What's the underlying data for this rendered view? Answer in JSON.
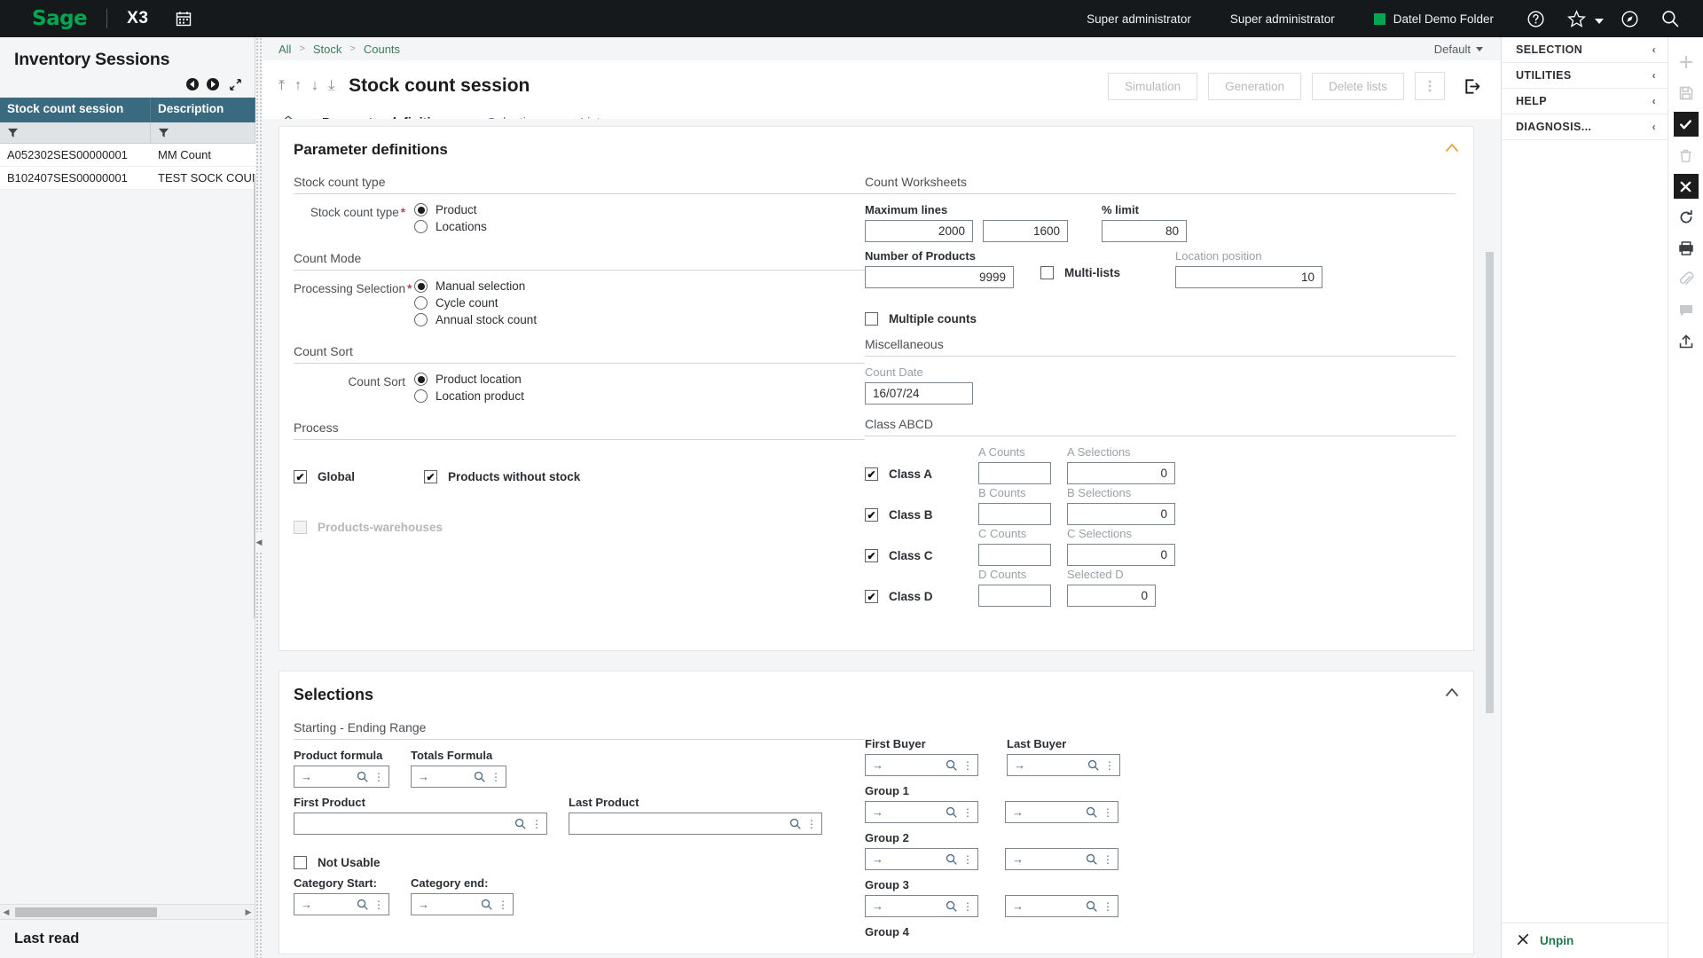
{
  "topbar": {
    "logo": "Sage",
    "product": "X3",
    "calendar_icon": "calendar-icon",
    "user_left": "Super administrator",
    "user_right": "Super administrator",
    "folder": "Datel Demo Folder",
    "icons": [
      "help-icon",
      "favorites-star-icon",
      "chevron-down-icon",
      "compass-icon",
      "search-icon"
    ]
  },
  "left_panel": {
    "title": "Inventory Sessions",
    "nav_prev": "◀",
    "nav_next": "▶",
    "expand_icon": "expand-icon",
    "columns": [
      "Stock count session",
      "Description"
    ],
    "filter_icon": "filter-icon",
    "rows": [
      {
        "session": "A052302SES00000001",
        "description": "MM Count"
      },
      {
        "session": "B102407SES00000001",
        "description": "TEST SOCK COUNT"
      }
    ],
    "footer_status": "Last read"
  },
  "breadcrumb": {
    "items": [
      "All",
      "Stock",
      "Counts"
    ],
    "separator": ">",
    "view_label": "Default"
  },
  "page": {
    "title": "Stock count session",
    "nav_icons": [
      "first-record-icon",
      "previous-record-icon",
      "next-record-icon",
      "last-record-icon"
    ],
    "buttons": [
      {
        "label": "Simulation",
        "name": "simulation-button"
      },
      {
        "label": "Generation",
        "name": "generation-button"
      },
      {
        "label": "Delete lists",
        "name": "delete-lists-button"
      }
    ],
    "kebab_icon": "more-options-icon",
    "exit_icon": "exit-icon",
    "tabs": [
      {
        "label": "Parameter definitions",
        "active": true
      },
      {
        "label": "Selections",
        "active": false
      },
      {
        "label": "Lists",
        "active": false
      }
    ],
    "home_icon": "home-icon"
  },
  "parameter_definitions": {
    "card_title": "Parameter definitions",
    "collapse_icon": "collapse-icon",
    "stock_count_type": {
      "section": "Stock count type",
      "label": "Stock count type",
      "required": "*",
      "options": [
        {
          "label": "Product",
          "selected": true
        },
        {
          "label": "Locations",
          "selected": false
        }
      ]
    },
    "count_mode": {
      "section": "Count Mode",
      "label": "Processing Selection",
      "required": "*",
      "options": [
        {
          "label": "Manual selection",
          "selected": true
        },
        {
          "label": "Cycle count",
          "selected": false
        },
        {
          "label": "Annual stock count",
          "selected": false
        }
      ]
    },
    "count_sort": {
      "section": "Count Sort",
      "label": "Count Sort",
      "options": [
        {
          "label": "Product location",
          "selected": true
        },
        {
          "label": "Location product",
          "selected": false
        }
      ]
    },
    "process": {
      "section": "Process",
      "checkboxes": [
        {
          "label": "Global",
          "checked": true,
          "disabled": false
        },
        {
          "label": "Products without stock",
          "checked": true,
          "disabled": false
        },
        {
          "label": "Products-warehouses",
          "checked": false,
          "disabled": true
        }
      ]
    },
    "count_worksheets": {
      "section": "Count Worksheets",
      "maximum_lines_label": "Maximum lines",
      "maximum_lines_value": "2000",
      "maximum_lines_value2": "1600",
      "percent_limit_label": "% limit",
      "percent_limit_value": "80",
      "number_of_products_label": "Number of Products",
      "number_of_products_value": "9999",
      "multi_lists_label": "Multi-lists",
      "multi_lists_checked": false,
      "location_position_label": "Location position",
      "location_position_value": "10",
      "multiple_counts_label": "Multiple counts",
      "multiple_counts_checked": false
    },
    "miscellaneous": {
      "section": "Miscellaneous",
      "count_date_label": "Count Date",
      "count_date_value": "16/07/24"
    },
    "class_abcd": {
      "section": "Class ABCD",
      "rows": [
        {
          "class_label": "Class A",
          "checked": true,
          "counts_label": "A Counts",
          "counts_value": "",
          "selections_label": "A Selections",
          "selections_value": "0"
        },
        {
          "class_label": "Class B",
          "checked": true,
          "counts_label": "B Counts",
          "counts_value": "",
          "selections_label": "B Selections",
          "selections_value": "0"
        },
        {
          "class_label": "Class C",
          "checked": true,
          "counts_label": "C Counts",
          "counts_value": "",
          "selections_label": "C Selections",
          "selections_value": "0"
        },
        {
          "class_label": "Class D",
          "checked": true,
          "counts_label": "D Counts",
          "counts_value": "",
          "selections_label": "Selected D",
          "selections_value": "0"
        }
      ]
    }
  },
  "selections": {
    "card_title": "Selections",
    "collapse_icon": "collapse-icon",
    "range_section": "Starting - Ending Range",
    "left": {
      "product_formula_label": "Product formula",
      "totals_formula_label": "Totals Formula",
      "first_product_label": "First Product",
      "last_product_label": "Last Product",
      "not_usable_label": "Not Usable",
      "not_usable_checked": false,
      "category_start_label": "Category Start:",
      "category_end_label": "Category end:"
    },
    "right": {
      "first_buyer_label": "First Buyer",
      "last_buyer_label": "Last Buyer",
      "group1_label": "Group 1",
      "group2_label": "Group 2",
      "group3_label": "Group 3",
      "group4_label": "Group 4"
    },
    "lookup_arrow": "→",
    "search_icon": "search-icon",
    "kebab_icon": "more-options-icon"
  },
  "right_panel": {
    "items": [
      {
        "label": "SELECTION",
        "name": "selection"
      },
      {
        "label": "UTILITIES",
        "name": "utilities"
      },
      {
        "label": "HELP",
        "name": "help"
      },
      {
        "label": "DIAGNOSIS...",
        "name": "diagnosis"
      }
    ],
    "chevron": "‹",
    "unpin_label": "Unpin",
    "unpin_icon": "unpin-icon"
  },
  "icon_rail": {
    "buttons": [
      {
        "name": "add-icon",
        "state": "disabled"
      },
      {
        "name": "save-icon",
        "state": "disabled"
      },
      {
        "name": "confirm-icon",
        "state": "active"
      },
      {
        "name": "delete-icon",
        "state": "disabled"
      },
      {
        "name": "close-icon",
        "state": "active"
      },
      {
        "name": "refresh-icon",
        "state": "enabled"
      },
      {
        "name": "print-icon",
        "state": "enabled"
      },
      {
        "name": "attachment-icon",
        "state": "disabled"
      },
      {
        "name": "comment-icon",
        "state": "disabled"
      },
      {
        "name": "export-icon",
        "state": "enabled"
      }
    ]
  },
  "colors": {
    "brand_green": "#00a651",
    "header_dark": "#16191c",
    "table_header": "#3a6a80",
    "required_red": "#b5455f",
    "link_green": "#3c7d5c"
  }
}
